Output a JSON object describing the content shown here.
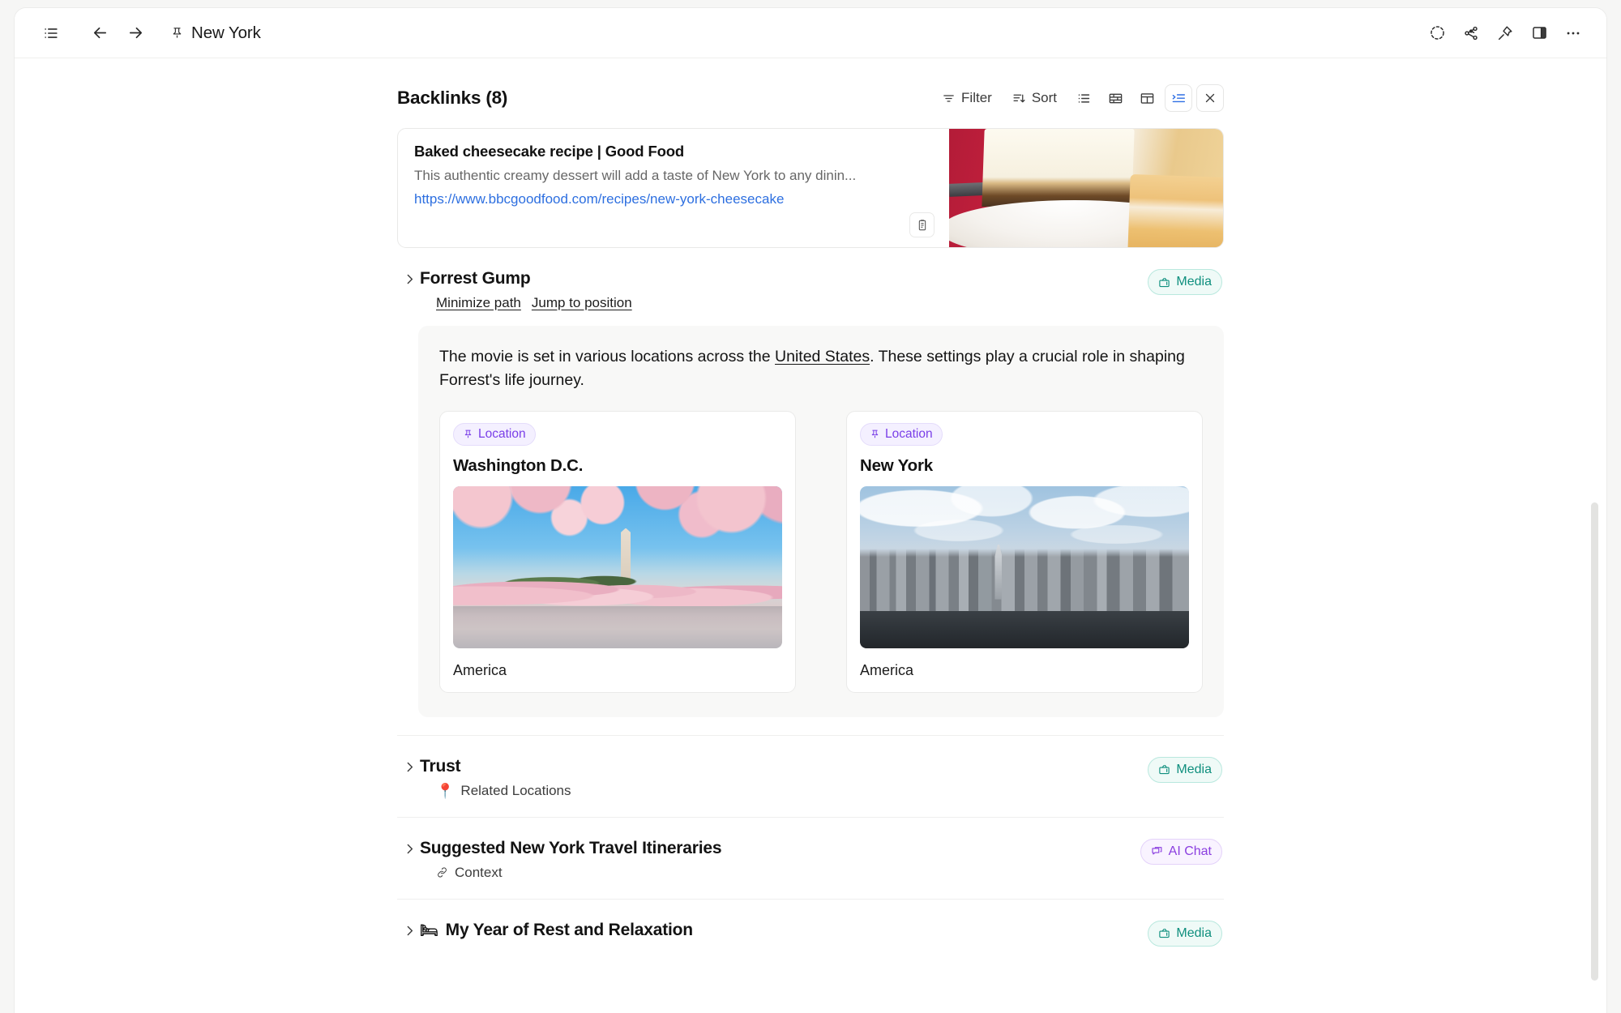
{
  "window": {
    "title": "New York",
    "nav": {
      "menu_icon": "list-menu-icon",
      "back_icon": "arrow-left-icon",
      "forward_icon": "arrow-right-icon",
      "title_icon": "pin-icon"
    },
    "right_actions": [
      {
        "name": "frame-dashed-circle-icon",
        "glyph": "circle-dashed"
      },
      {
        "name": "graph-nodes-icon",
        "glyph": "graph"
      },
      {
        "name": "pin-icon",
        "glyph": "pin"
      },
      {
        "name": "right-panel-icon",
        "glyph": "panel"
      },
      {
        "name": "more-options-icon",
        "glyph": "ellipsis"
      }
    ]
  },
  "backlinks": {
    "title": "Backlinks (8)",
    "count": 8,
    "toolbar": {
      "filter_label": "Filter",
      "sort_label": "Sort",
      "views": [
        {
          "name": "list-view",
          "active": false
        },
        {
          "name": "gallery-view",
          "active": false
        },
        {
          "name": "table-view",
          "active": false
        },
        {
          "name": "detail-view",
          "active": true
        }
      ],
      "close_label": "✕",
      "active_accent": "#2f6fe4"
    }
  },
  "bookmark": {
    "title": "Baked cheesecake recipe | Good Food",
    "description": "This authentic creamy dessert will add a taste of New York to any dinin...",
    "url": "https://www.bbcgoodfood.com/recipes/new-york-cheesecake",
    "url_color": "#2d6fe0",
    "copy_icon": "clipboard-icon",
    "thumbnail_alt": "slice of baked cheesecake on a red plate"
  },
  "sections": [
    {
      "title": "Forrest Gump",
      "badge": {
        "label": "Media",
        "icon": "tv-icon",
        "color": "#0f8f7e"
      },
      "links": [
        "Minimize path",
        "Jump to position"
      ],
      "expanded": true,
      "body": {
        "paragraph_before": "The movie is set in various locations across the ",
        "paragraph_link": "United States",
        "paragraph_after": ". These settings play a crucial role in shaping Forrest's life journey.",
        "cards": [
          {
            "pill": "Location",
            "pill_icon": "pin-icon",
            "name": "Washington D.C.",
            "caption": "America",
            "image_alt": "cherry blossoms and Washington Monument by the Tidal Basin"
          },
          {
            "pill": "Location",
            "pill_icon": "pin-icon",
            "name": "New York",
            "caption": "America",
            "image_alt": "Manhattan skyline at dusk over the river"
          }
        ]
      }
    },
    {
      "title": "Trust",
      "badge": {
        "label": "Media",
        "icon": "tv-icon",
        "color": "#0f8f7e"
      },
      "sub_icon": "📍",
      "sub_label": "Related Locations",
      "expanded": false
    },
    {
      "title": "Suggested New York Travel Itineraries",
      "badge": {
        "label": "AI Chat",
        "icon": "chat-bubble-icon",
        "color": "#8b3fe0"
      },
      "sub_icon": "🔗",
      "sub_label": "Context",
      "expanded": false
    },
    {
      "title": "My Year of Rest and Relaxation",
      "title_emoji": "🛏",
      "badge": {
        "label": "Media",
        "icon": "tv-icon",
        "color": "#0f8f7e"
      },
      "expanded": false
    }
  ]
}
